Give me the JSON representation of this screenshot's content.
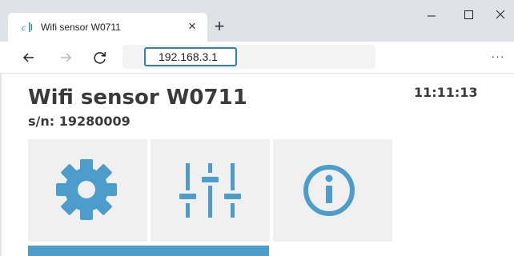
{
  "browser": {
    "tab_title": "Wifi sensor W0711",
    "tab_close_glyph": "×",
    "new_tab_glyph": "+",
    "url": "192.168.3.1",
    "more_glyph": "···"
  },
  "page": {
    "title": "Wifi sensor W0711",
    "serial": "s/n: 19280009",
    "time": "11:11:13"
  },
  "tiles": [
    {
      "icon": "gear-icon"
    },
    {
      "icon": "sliders-icon"
    },
    {
      "icon": "info-icon"
    }
  ],
  "colors": {
    "accent": "#4c9ccc",
    "tile_bg": "#f0f0f0",
    "text": "#3a3a3a",
    "url_border": "#2f80b8"
  }
}
